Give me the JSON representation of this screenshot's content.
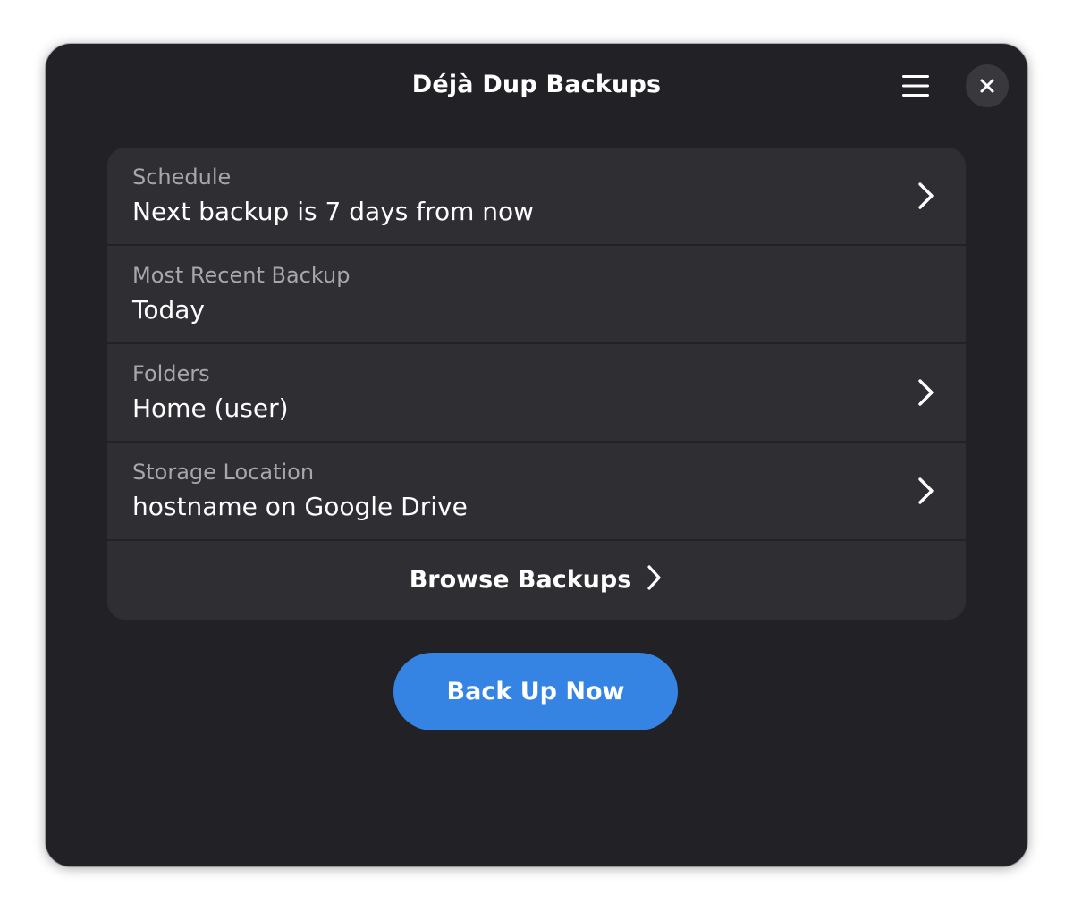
{
  "window": {
    "title": "Déjà Dup Backups"
  },
  "header": {
    "menu_icon": "hamburger-menu-icon",
    "close_icon": "close-icon"
  },
  "rows": [
    {
      "subtitle": "Schedule",
      "title": "Next backup is 7 days from now",
      "has_chevron": true
    },
    {
      "subtitle": "Most Recent Backup",
      "title": "Today",
      "has_chevron": false
    },
    {
      "subtitle": "Folders",
      "title": "Home (user)",
      "has_chevron": true
    },
    {
      "subtitle": "Storage Location",
      "title": "hostname on Google Drive",
      "has_chevron": true
    }
  ],
  "browse": {
    "label": "Browse Backups"
  },
  "primary_action": {
    "label": "Back Up Now"
  },
  "colors": {
    "window_bg": "#222226",
    "card_bg": "#2e2e33",
    "accent": "#3584e4",
    "subtitle_text": "#a6a6ab",
    "text": "#ffffff"
  }
}
